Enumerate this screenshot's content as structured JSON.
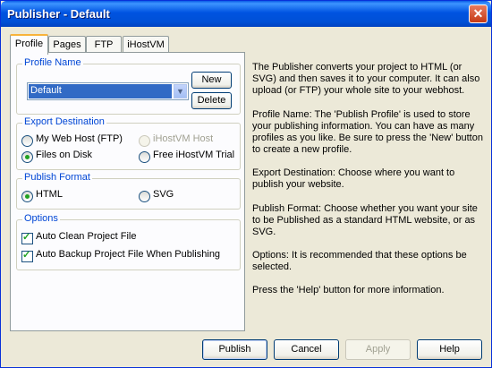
{
  "window": {
    "title": "Publisher - Default",
    "close_glyph": "✕"
  },
  "tabs": [
    "Profile",
    "Pages",
    "FTP",
    "iHostVM"
  ],
  "profile_name": {
    "legend": "Profile Name",
    "selected": "Default",
    "new_label": "New",
    "delete_label": "Delete"
  },
  "export_destination": {
    "legend": "Export Destination",
    "options": [
      {
        "label": "My Web Host (FTP)",
        "checked": false,
        "enabled": true
      },
      {
        "label": "iHostVM Host",
        "checked": false,
        "enabled": false
      },
      {
        "label": "Files on Disk",
        "checked": true,
        "enabled": true
      },
      {
        "label": "Free iHostVM Trial",
        "checked": false,
        "enabled": true
      }
    ]
  },
  "publish_format": {
    "legend": "Publish Format",
    "options": [
      {
        "label": "HTML",
        "checked": true
      },
      {
        "label": "SVG",
        "checked": false
      }
    ]
  },
  "options": {
    "legend": "Options",
    "items": [
      {
        "label": "Auto Clean Project File",
        "checked": true
      },
      {
        "label": "Auto Backup Project File When Publishing",
        "checked": true
      }
    ]
  },
  "help_text": [
    "The Publisher converts your project to HTML (or SVG) and then saves it to your computer. It can also upload (or FTP) your whole site to your webhost.",
    "Profile Name: The 'Publish Profile' is used to store your publishing information. You can have as many profiles as you like. Be sure to press the 'New' button to create a new profile.",
    "Export Destination: Choose where you want to publish your website.",
    "Publish Format: Choose whether you want your site to be Published as a standard HTML website, or as SVG.",
    "Options: It is recommended that these options be selected.",
    "Press the 'Help' button for more information."
  ],
  "buttons": {
    "publish": "Publish",
    "cancel": "Cancel",
    "apply": "Apply",
    "help": "Help"
  },
  "colors": {
    "title_bar": "#0053e1",
    "group_legend": "#0046d5",
    "radio_dot": "#21a121",
    "selection": "#316ac5"
  }
}
